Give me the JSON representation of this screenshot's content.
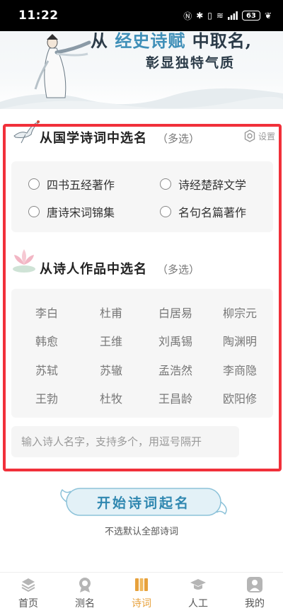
{
  "status_bar": {
    "time": "11:22",
    "battery": "63"
  },
  "banner": {
    "line1_prefix": "从",
    "line1_highlight": "经史诗赋",
    "line1_suffix": "中取名,",
    "line2": "彰显独特气质"
  },
  "section_guoxue": {
    "title": "从国学诗词中选名",
    "sub": "（多选）",
    "settings_label": "设置",
    "options": [
      "四书五经著作",
      "诗经楚辞文学",
      "唐诗宋词锦集",
      "名句名篇著作"
    ]
  },
  "section_poets": {
    "title": "从诗人作品中选名",
    "sub": "（多选）",
    "poets": [
      "李白",
      "杜甫",
      "白居易",
      "柳宗元",
      "韩愈",
      "王维",
      "刘禹锡",
      "陶渊明",
      "苏轼",
      "苏辙",
      "孟浩然",
      "李商隐",
      "王勃",
      "杜牧",
      "王昌龄",
      "欧阳修"
    ],
    "input_placeholder": "输入诗人名字，支持多个，用逗号隔开"
  },
  "start": {
    "label": "开始诗词起名",
    "hint": "不选默认全部诗词"
  },
  "bottom_nav": {
    "items": [
      "首页",
      "测名",
      "诗词",
      "人工",
      "我的"
    ],
    "active_index": 2
  },
  "colors": {
    "accent": "#e7a13b",
    "highlight_frame": "#f1303a",
    "brand_blue": "#2f87b0"
  }
}
